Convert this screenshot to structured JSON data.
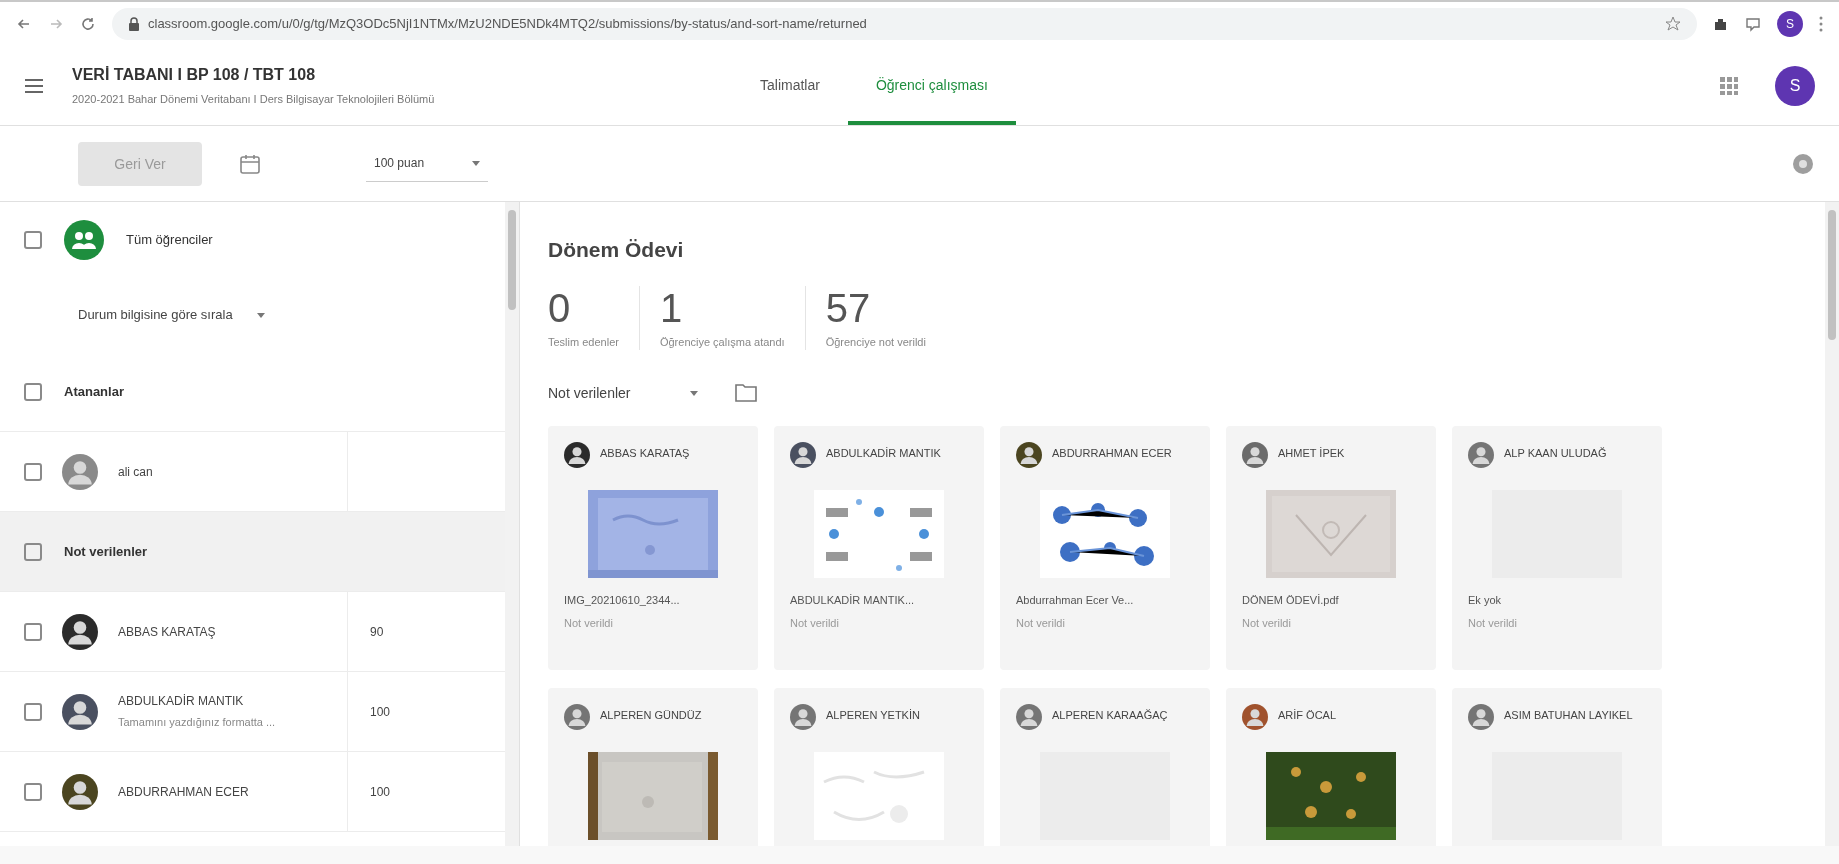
{
  "browser": {
    "url": "classroom.google.com/u/0/g/tg/MzQ3ODc5NjI1NTMx/MzU2NDE5NDk4MTQ2/submissions/by-status/and-sort-name/returned",
    "profile_initial": "S"
  },
  "header": {
    "title": "VERİ TABANI I BP 108 / TBT 108",
    "subtitle": "2020-2021 Bahar Dönemi Veritabanı I Ders Bilgisayar Teknolojileri Bölümü",
    "account_initial": "S"
  },
  "tabs": [
    {
      "label": "Talimatlar",
      "selected": false
    },
    {
      "label": "Öğrenci çalışması",
      "selected": true
    }
  ],
  "toolbar": {
    "return_button": {
      "label": "Geri Ver",
      "disabled": true
    },
    "points": "100 puan"
  },
  "roster": {
    "all": {
      "label": "Tüm öğrenciler",
      "checked": false
    },
    "sort": "Durum bilgisine göre sırala",
    "groups": [
      {
        "label": "Atananlar",
        "checked": false,
        "shaded": false,
        "students": [
          {
            "name": "ali can",
            "color": "#8a8a8a",
            "checked": false
          }
        ]
      },
      {
        "label": "Not verilenler",
        "checked": false,
        "shaded": true,
        "students": [
          {
            "name": "ABBAS KARATAŞ",
            "grade": "90",
            "color": "#2b2b2b",
            "checked": false
          },
          {
            "name": "ABDULKADİR MANTIK",
            "note": "Tamamını yazdığınız formatta ...",
            "grade": "100",
            "color": "#4a5060",
            "checked": false
          },
          {
            "name": "ABDURRAHMAN ECER",
            "grade": "100",
            "color": "#4b4520",
            "checked": false
          }
        ]
      }
    ]
  },
  "assignment": {
    "title": "Dönem Ödevi",
    "stats": [
      {
        "value": "0",
        "label": "Teslim edenler"
      },
      {
        "value": "1",
        "label": "Öğrenciye çalışma atandı"
      },
      {
        "value": "57",
        "label": "Öğrenciye not verildi"
      }
    ],
    "filter": "Not verilenler",
    "cards": [
      {
        "name": "ABBAS KARATAŞ",
        "color": "#2b2b2b",
        "file": "IMG_20210610_2344...",
        "status": "Not verildi"
      },
      {
        "name": "ABDULKADİR MANTIK",
        "color": "#4a5060",
        "file": "ABDULKADİR MANTIK...",
        "status": "Not verildi"
      },
      {
        "name": "ABDURRAHMAN ECER",
        "color": "#4b4520",
        "file": "Abdurrahman Ecer Ve...",
        "status": "Not verildi"
      },
      {
        "name": "AHMET İPEK",
        "color": "#6b6b6b",
        "file": "DÖNEM ÖDEVİ.pdf",
        "status": "Not verildi"
      },
      {
        "name": "ALP KAAN ULUDAĞ",
        "color": "#757575",
        "file": "Ek yok",
        "status": "Not verildi"
      },
      {
        "name": "ALPEREN GÜNDÜZ",
        "color": "#757575"
      },
      {
        "name": "ALPEREN YETKİN",
        "color": "#757575"
      },
      {
        "name": "ALPEREN KARAAĞAÇ",
        "color": "#757575"
      },
      {
        "name": "ARİF ÖCAL",
        "color": "#a0522d"
      },
      {
        "name": "ASIM BATUHAN LAYIKEL",
        "color": "#757575"
      }
    ]
  }
}
